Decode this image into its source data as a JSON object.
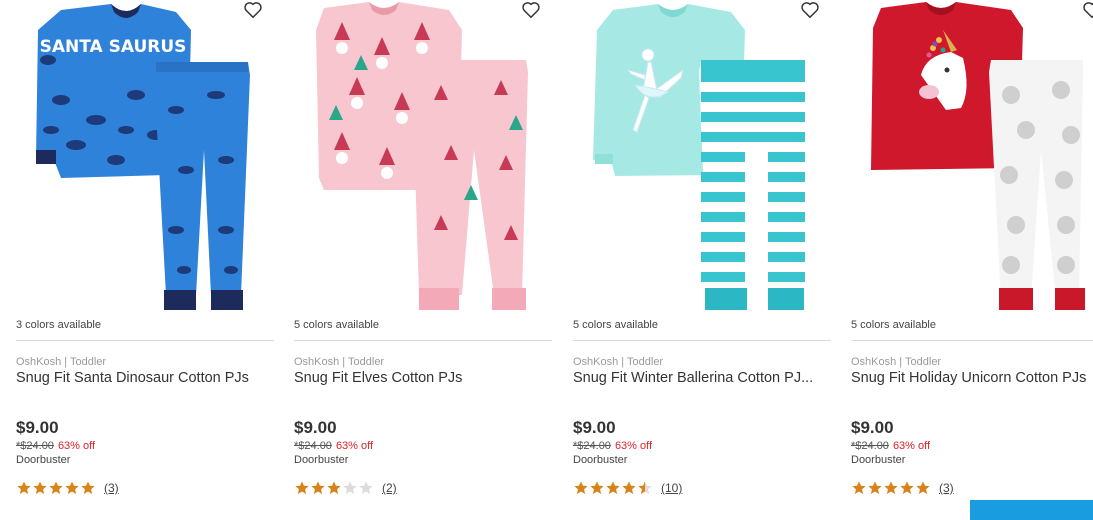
{
  "colors": {
    "star": "#d8821a",
    "star_empty": "#dcdcdc",
    "discount": "#e11f26",
    "feedback_tab": "#1a9ce0"
  },
  "products": [
    {
      "colors_text": "3 colors available",
      "brand": "OshKosh | Toddler",
      "title": "Snug Fit Santa Dinosaur Cotton PJs",
      "price": "$9.00",
      "original_price": "*$24.00",
      "discount": "63% off",
      "deal": "Doorbuster",
      "rating": 5,
      "review_count": "(3)",
      "top_text": "SANTA SAURUS"
    },
    {
      "colors_text": "5 colors available",
      "brand": "OshKosh | Toddler",
      "title": "Snug Fit Elves Cotton PJs",
      "price": "$9.00",
      "original_price": "*$24.00",
      "discount": "63% off",
      "deal": "Doorbuster",
      "rating": 3,
      "review_count": "(2)"
    },
    {
      "colors_text": "5 colors available",
      "brand": "OshKosh | Toddler",
      "title": "Snug Fit Winter Ballerina Cotton PJ...",
      "price": "$9.00",
      "original_price": "*$24.00",
      "discount": "63% off",
      "deal": "Doorbuster",
      "rating": 4.5,
      "review_count": "(10)"
    },
    {
      "colors_text": "5 colors available",
      "brand": "OshKosh | Toddler",
      "title": "Snug Fit Holiday Unicorn Cotton PJs",
      "price": "$9.00",
      "original_price": "*$24.00",
      "discount": "63% off",
      "deal": "Doorbuster",
      "rating": 5,
      "review_count": "(3)"
    }
  ]
}
